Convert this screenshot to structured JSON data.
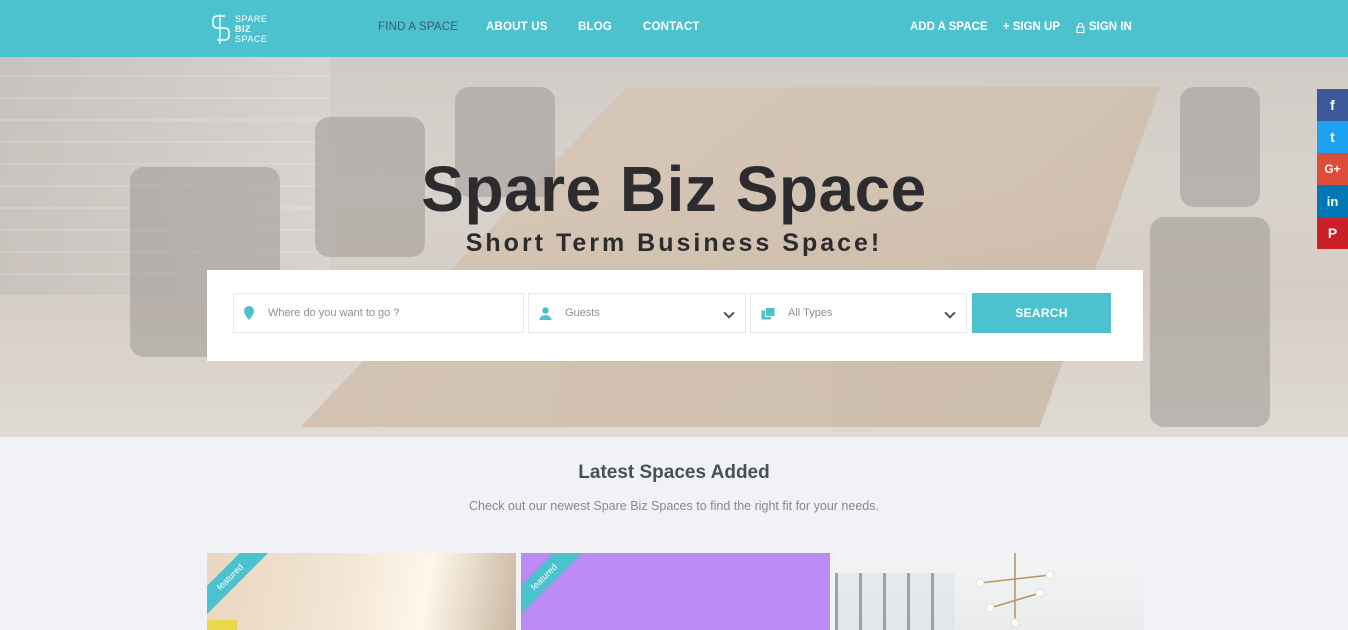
{
  "header": {
    "logo": {
      "line1": "SPARE",
      "line2": "BIZ",
      "line3": "SPACE"
    },
    "nav": [
      "FIND A SPACE",
      "ABOUT US",
      "BLOG",
      "CONTACT"
    ],
    "add_space": "ADD A SPACE",
    "sign_up": "SIGN UP",
    "sign_in": "SIGN IN"
  },
  "hero": {
    "title": "Spare Biz Space",
    "subtitle": "Short Term Business Space!"
  },
  "search": {
    "location_placeholder": "Where do you want to go ?",
    "guests_placeholder": "Guests",
    "types_placeholder": "All Types",
    "button": "SEARCH"
  },
  "social": {
    "facebook": "f",
    "twitter": "t",
    "google": "G+",
    "linkedin": "in",
    "pinterest": "P"
  },
  "latest": {
    "title": "Latest Spaces Added",
    "subtitle": "Check out our newest Spare Biz Spaces to find the right fit for your needs.",
    "cards": [
      {
        "badge": "featured"
      },
      {
        "badge": "featured"
      },
      {
        "badge": ""
      }
    ]
  },
  "colors": {
    "brand": "#4cc2cf",
    "facebook": "#3b5998",
    "twitter": "#1da1f2",
    "google": "#dd4b39",
    "linkedin": "#0077b5",
    "pinterest": "#cb2027"
  }
}
